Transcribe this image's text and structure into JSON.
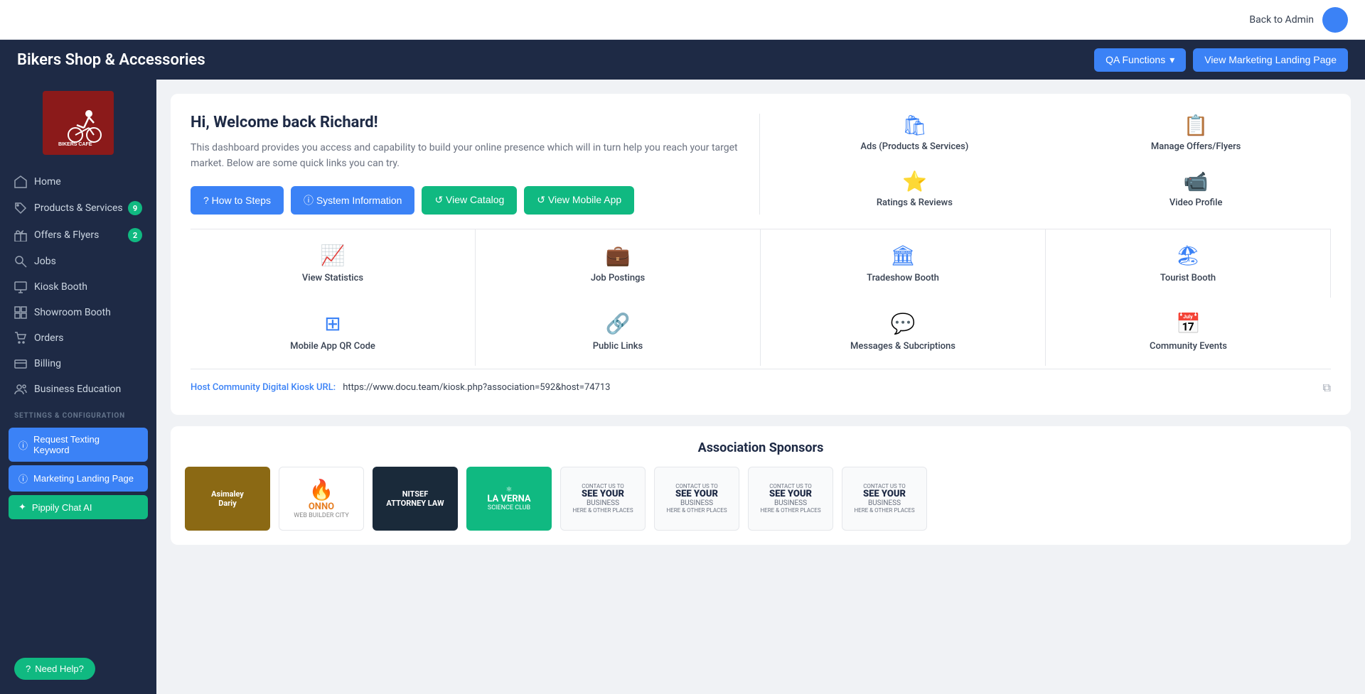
{
  "topbar": {
    "back_label": "Back to Admin"
  },
  "header": {
    "title": "Bikers Shop & Accessories",
    "qa_label": "QA Functions",
    "view_landing_label": "View Marketing Landing Page"
  },
  "sidebar": {
    "nav_items": [
      {
        "id": "home",
        "label": "Home",
        "icon": "home",
        "badge": null
      },
      {
        "id": "products",
        "label": "Products & Services",
        "icon": "tag",
        "badge": "9"
      },
      {
        "id": "offers",
        "label": "Offers & Flyers",
        "icon": "gift",
        "badge": "2"
      },
      {
        "id": "jobs",
        "label": "Jobs",
        "icon": "key",
        "badge": null
      },
      {
        "id": "kiosk",
        "label": "Kiosk Booth",
        "icon": "monitor",
        "badge": null
      },
      {
        "id": "showroom",
        "label": "Showroom Booth",
        "icon": "grid",
        "badge": null
      },
      {
        "id": "orders",
        "label": "Orders",
        "icon": "cart",
        "badge": null
      },
      {
        "id": "billing",
        "label": "Billing",
        "icon": "credit",
        "badge": null
      },
      {
        "id": "education",
        "label": "Business Education",
        "icon": "users",
        "badge": null
      }
    ],
    "settings_label": "SETTINGS & CONFIGURATION",
    "buttons": [
      {
        "id": "texting",
        "label": "Request Texting Keyword",
        "style": "blue"
      },
      {
        "id": "landing",
        "label": "Marketing Landing Page",
        "style": "blue"
      },
      {
        "id": "chat",
        "label": "Pippily Chat AI",
        "style": "green"
      }
    ]
  },
  "welcome": {
    "title": "Hi, Welcome back Richard!",
    "description": "This dashboard provides you access and capability to build your online presence which will in turn help you reach your target market. Below are some quick links you can try.",
    "buttons": [
      {
        "id": "how-to",
        "label": "? How to Steps",
        "style": "blue"
      },
      {
        "id": "system-info",
        "label": "ⓘ System Information",
        "style": "blue"
      },
      {
        "id": "view-catalog",
        "label": "↺ View Catalog",
        "style": "green"
      },
      {
        "id": "view-mobile",
        "label": "↺ View Mobile App",
        "style": "green"
      }
    ],
    "quick_links": [
      {
        "id": "ads",
        "label": "Ads (Products & Services)",
        "icon": "🛍"
      },
      {
        "id": "offers-flyers",
        "label": "Manage Offers/Flyers",
        "icon": "📋"
      },
      {
        "id": "ratings",
        "label": "Ratings & Reviews",
        "icon": "⭐"
      },
      {
        "id": "video",
        "label": "Video Profile",
        "icon": "📹"
      }
    ]
  },
  "grid_items": [
    {
      "id": "statistics",
      "label": "View Statistics",
      "icon": "📈"
    },
    {
      "id": "jobs",
      "label": "Job Postings",
      "icon": "💼"
    },
    {
      "id": "tradeshow",
      "label": "Tradeshow Booth",
      "icon": "🏛"
    },
    {
      "id": "tourist",
      "label": "Tourist Booth",
      "icon": "🏖"
    },
    {
      "id": "qr-code",
      "label": "Mobile App QR Code",
      "icon": "⊞"
    },
    {
      "id": "public-links",
      "label": "Public Links",
      "icon": "🔗"
    },
    {
      "id": "messages",
      "label": "Messages & Subcriptions",
      "icon": "💬"
    },
    {
      "id": "community",
      "label": "Community Events",
      "icon": "📅"
    }
  ],
  "url_section": {
    "label": "Host Community Digital Kiosk URL:",
    "url": "https://www.docu.team/kiosk.php?association=592&host=74713"
  },
  "sponsors": {
    "title": "Association Sponsors",
    "items": [
      {
        "id": "asimaley",
        "name": "Asimaley",
        "type": "asimaley"
      },
      {
        "id": "onno",
        "name": "ONNO",
        "type": "onno"
      },
      {
        "id": "nitsef",
        "name": "NITSEF",
        "type": "nitsef"
      },
      {
        "id": "laverna",
        "name": "LA VERNA",
        "type": "laverna"
      },
      {
        "id": "see1",
        "name": "See Your Business",
        "type": "see"
      },
      {
        "id": "see2",
        "name": "See Your Business",
        "type": "see"
      },
      {
        "id": "see3",
        "name": "See Your Business",
        "type": "see"
      },
      {
        "id": "see4",
        "name": "See Your Business",
        "type": "see"
      }
    ]
  },
  "need_help": "Need Help?"
}
